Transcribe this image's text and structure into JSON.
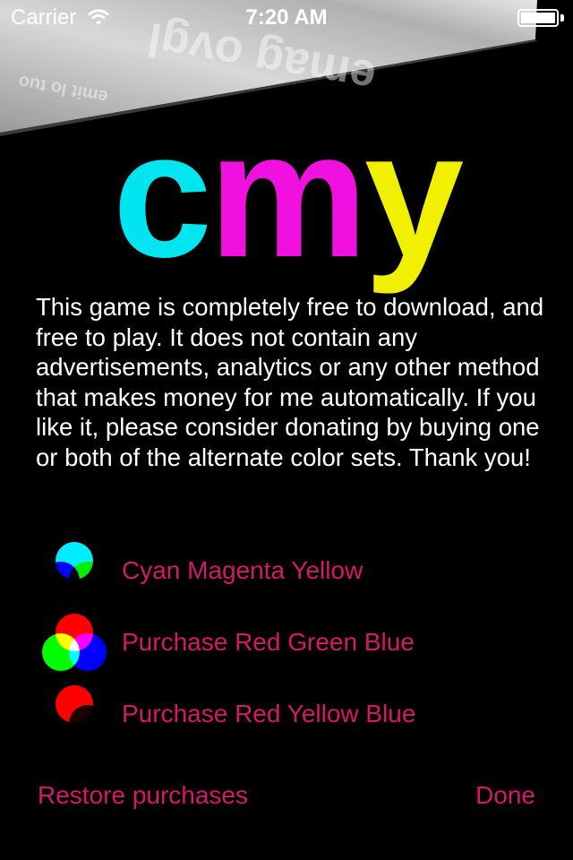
{
  "status_bar": {
    "carrier": "Carrier",
    "time": "7:20 AM"
  },
  "logo": {
    "c": "c",
    "m": "m",
    "y": "y",
    "colors": {
      "c": "#00e5f0",
      "m": "#f010e0",
      "y": "#f0f000"
    }
  },
  "description": "This game is completely free to download, and free to play. It does not contain any advertisements, analytics or any other method that makes money for me automatically. If you like it, please consider donating by buying one or both of the alternate color sets. Thank you!",
  "options": [
    {
      "label": "Cyan Magenta Yellow",
      "icon": "cmy-venn-icon"
    },
    {
      "label": "Purchase Red Green Blue",
      "icon": "rgb-venn-icon"
    },
    {
      "label": "Purchase Red Yellow Blue",
      "icon": "ryb-venn-icon"
    }
  ],
  "buttons": {
    "restore": "Restore purchases",
    "done": "Done"
  },
  "accent_color": "#d4186c"
}
